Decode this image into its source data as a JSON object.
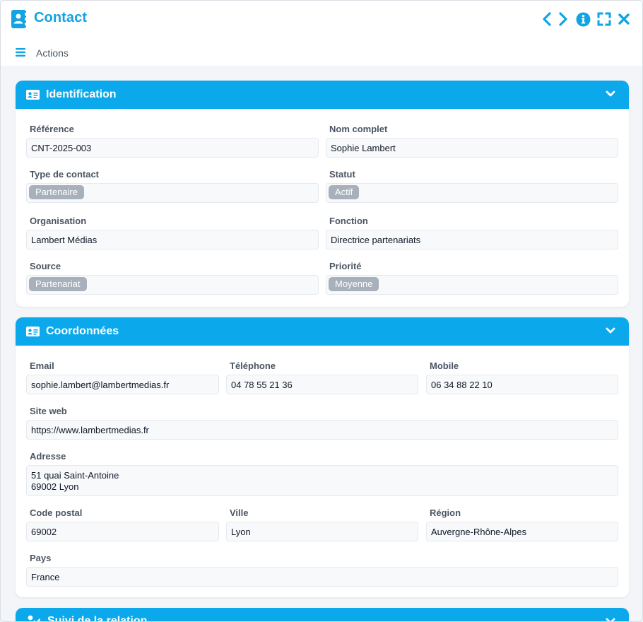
{
  "window": {
    "title": "Contact",
    "actions_label": "Actions",
    "accent": "#0ba9ec"
  },
  "sections": {
    "identification": {
      "title": "Identification",
      "fields": {
        "reference": {
          "label": "Référence",
          "value": "CNT-2025-003"
        },
        "nom_complet": {
          "label": "Nom complet",
          "value": "Sophie Lambert"
        },
        "type_contact": {
          "label": "Type de contact",
          "value": "Partenaire"
        },
        "statut": {
          "label": "Statut",
          "value": "Actif"
        },
        "organisation": {
          "label": "Organisation",
          "value": "Lambert Médias"
        },
        "fonction": {
          "label": "Fonction",
          "value": "Directrice partenariats"
        },
        "source": {
          "label": "Source",
          "value": "Partenariat"
        },
        "priorite": {
          "label": "Priorité",
          "value": "Moyenne"
        }
      }
    },
    "coordonnees": {
      "title": "Coordonnées",
      "fields": {
        "email": {
          "label": "Email",
          "value": "sophie.lambert@lambertmedias.fr"
        },
        "telephone": {
          "label": "Téléphone",
          "value": "04 78 55 21 36"
        },
        "mobile": {
          "label": "Mobile",
          "value": "06 34 88 22 10"
        },
        "site_web": {
          "label": "Site web",
          "value": "https://www.lambertmedias.fr"
        },
        "adresse": {
          "label": "Adresse",
          "value": "51 quai Saint-Antoine\n69002 Lyon"
        },
        "code_postal": {
          "label": "Code postal",
          "value": "69002"
        },
        "ville": {
          "label": "Ville",
          "value": "Lyon"
        },
        "region": {
          "label": "Région",
          "value": "Auvergne-Rhône-Alpes"
        },
        "pays": {
          "label": "Pays",
          "value": "France"
        }
      }
    },
    "suivi": {
      "title": "Suivi de la relation"
    }
  },
  "icons": {
    "title": "address-book-icon",
    "prev": "chevron-left-icon",
    "next": "chevron-right-icon",
    "info": "info-circle-icon",
    "expand": "expand-icon",
    "close": "close-icon",
    "menu": "hamburger-icon",
    "identification": "id-card-icon",
    "coordonnees": "id-card-icon",
    "suivi": "user-handshake-icon",
    "collapse": "chevron-down-icon"
  }
}
